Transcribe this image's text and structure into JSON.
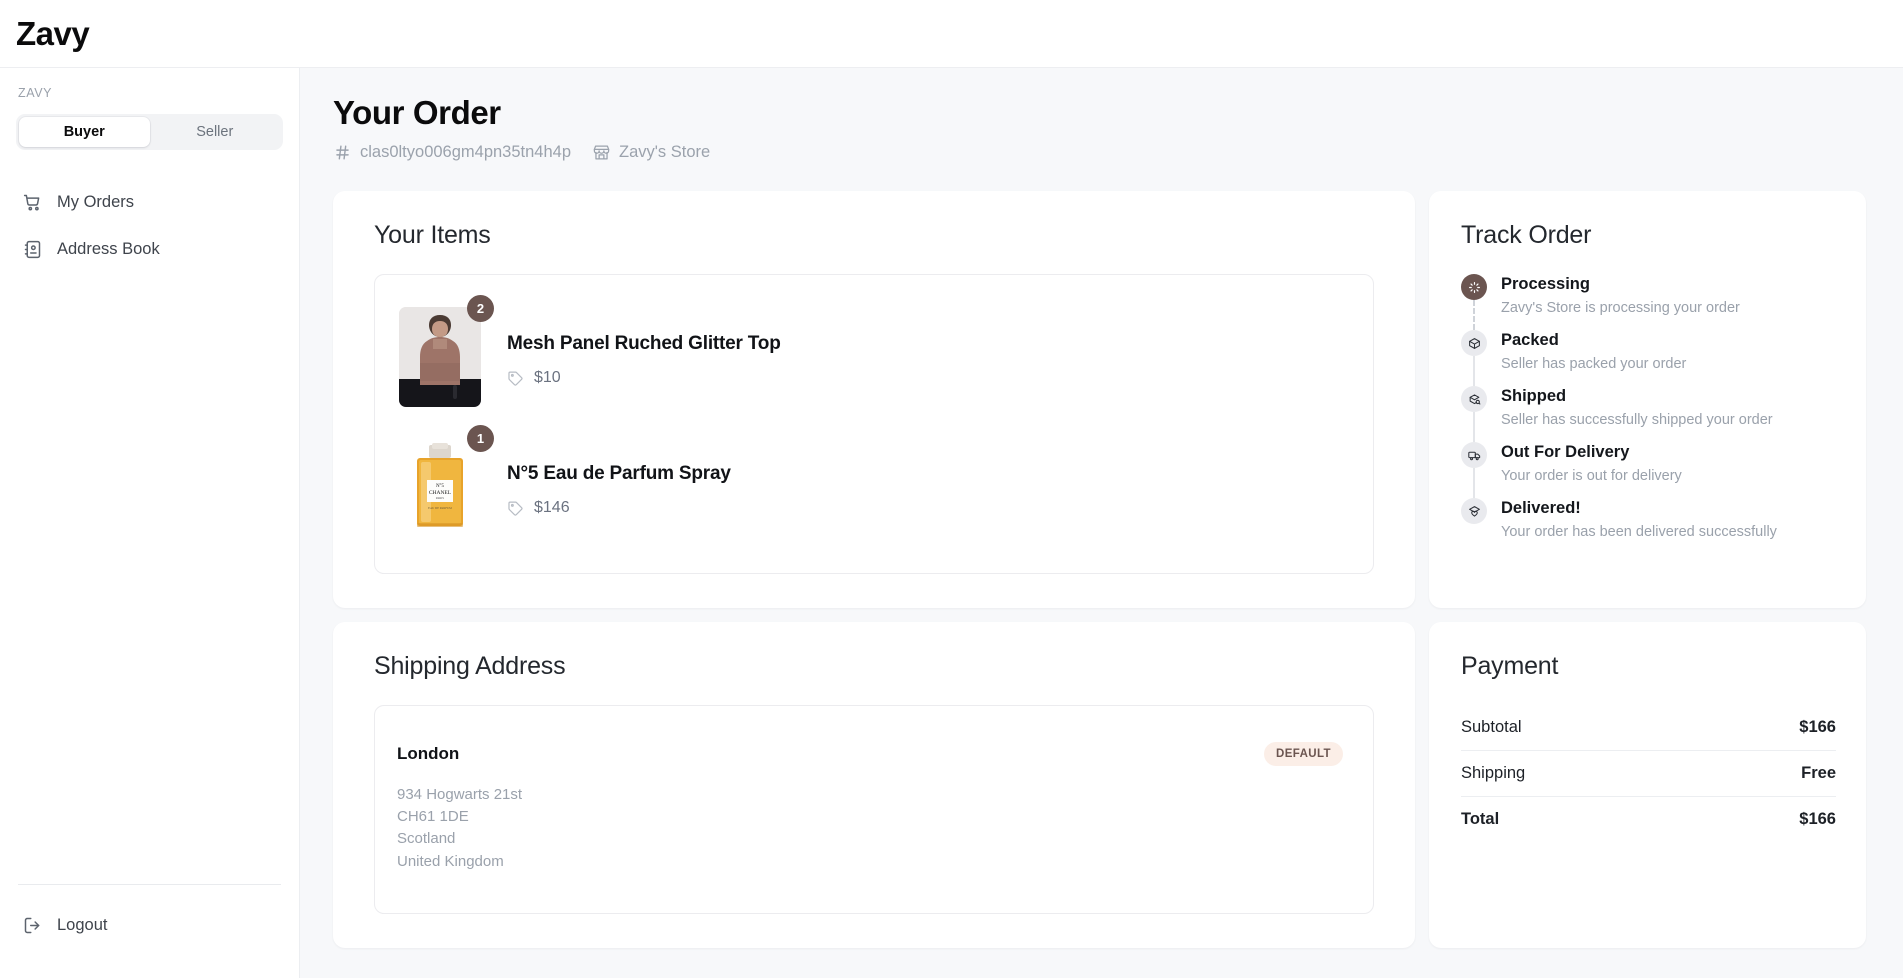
{
  "brand": "Zavy",
  "sidebar": {
    "section_label": "ZAVY",
    "role_toggle": {
      "buyer": "Buyer",
      "seller": "Seller",
      "active": "Buyer"
    },
    "items": [
      {
        "label": "My Orders",
        "icon": "shopping-cart-icon"
      },
      {
        "label": "Address Book",
        "icon": "address-book-icon"
      }
    ],
    "logout": {
      "label": "Logout",
      "icon": "logout-icon"
    }
  },
  "header": {
    "title": "Your Order",
    "order_id": "clas0ltyo006gm4pn35tn4h4p",
    "store_name": "Zavy's Store"
  },
  "items_card": {
    "title": "Your Items",
    "items": [
      {
        "name": "Mesh Panel Ruched Glitter Top",
        "price": "$10",
        "qty": "2"
      },
      {
        "name": "N°5 Eau de Parfum Spray",
        "price": "$146",
        "qty": "1"
      }
    ]
  },
  "track_order": {
    "title": "Track Order",
    "steps": [
      {
        "title": "Processing",
        "sub": "Zavy's Store is processing your order",
        "icon": "loader-icon",
        "active": true
      },
      {
        "title": "Packed",
        "sub": "Seller has packed your order",
        "icon": "package-icon",
        "active": false
      },
      {
        "title": "Shipped",
        "sub": "Seller has successfully shipped your order",
        "icon": "package-search-icon",
        "active": false
      },
      {
        "title": "Out For Delivery",
        "sub": "Your order is out for delivery",
        "icon": "truck-icon",
        "active": false
      },
      {
        "title": "Delivered!",
        "sub": "Your order has been delivered successfully",
        "icon": "package-heart-icon",
        "active": false
      }
    ]
  },
  "shipping": {
    "title": "Shipping Address",
    "city": "London",
    "badge": "DEFAULT",
    "line1": "934 Hogwarts 21st",
    "line2": "CH61 1DE",
    "line3": "Scotland",
    "line4": "United Kingdom"
  },
  "payment": {
    "title": "Payment",
    "rows": [
      {
        "label": "Subtotal",
        "value": "$166"
      },
      {
        "label": "Shipping",
        "value": "Free"
      },
      {
        "label": "Total",
        "value": "$166"
      }
    ]
  },
  "colors": {
    "accent_brown": "#6B5550",
    "badge_bg": "#FBEEE7",
    "page_bg": "#F7F8FA",
    "card_bg": "#FFFFFF"
  }
}
